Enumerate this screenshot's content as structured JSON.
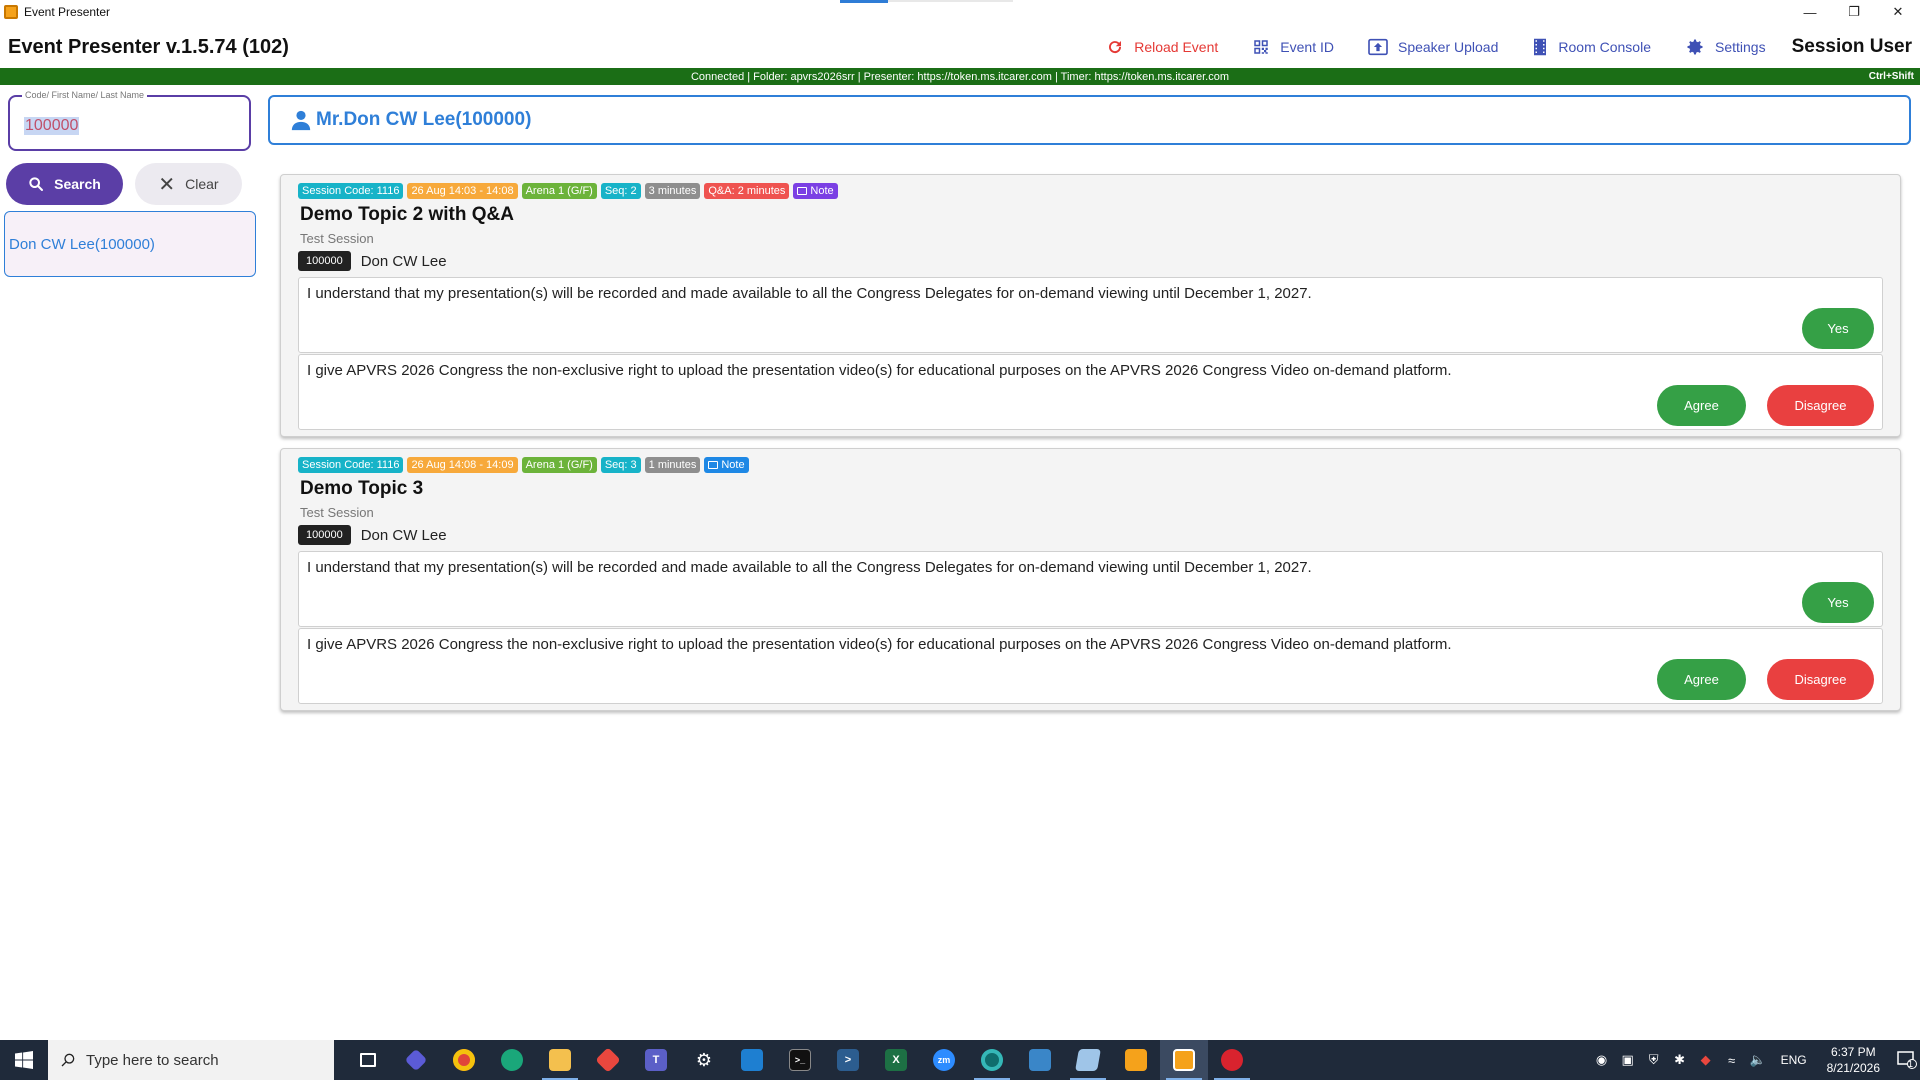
{
  "window": {
    "title": "Event Presenter"
  },
  "header": {
    "app_name": "Event Presenter v.1.5.74 (102)",
    "actions": {
      "reload": "Reload Event",
      "event_id": "Event ID",
      "speaker_upload": "Speaker Upload",
      "room_console": "Room Console",
      "settings": "Settings"
    },
    "session_user": "Session User"
  },
  "status": {
    "text": "Connected | Folder: apvrs2026srr | Presenter: https://token.ms.itcarer.com | Timer: https://token.ms.itcarer.com",
    "shortcut": "Ctrl+Shift"
  },
  "search": {
    "label": "Code/ First Name/ Last Name",
    "value": "100000",
    "search_button": "Search",
    "clear_button": "Clear",
    "results": [
      "Don CW Lee(100000)"
    ]
  },
  "presenter": {
    "name": "Mr.Don CW Lee(100000)"
  },
  "sessions": [
    {
      "badges": {
        "code": "Session Code: 1116",
        "time": "26 Aug 14:03 - 14:08",
        "room": "Arena 1 (G/F)",
        "seq": "Seq: 2",
        "duration": "3 minutes",
        "qa": "Q&A: 2 minutes",
        "note": "Note"
      },
      "title": "Demo Topic 2 with Q&A",
      "subtitle": "Test Session",
      "speaker_code": "100000",
      "speaker_name": "Don CW Lee",
      "consent1": "I understand that my presentation(s) will be recorded and made available to all the Congress Delegates for on-demand viewing until December 1, 2027.",
      "consent1_button": "Yes",
      "consent2": "I give APVRS 2026 Congress the non-exclusive right to upload the presentation video(s) for educational purposes on the APVRS 2026 Congress Video on-demand platform.",
      "agree": "Agree",
      "disagree": "Disagree"
    },
    {
      "badges": {
        "code": "Session Code: 1116",
        "time": "26 Aug 14:08 - 14:09",
        "room": "Arena 1 (G/F)",
        "seq": "Seq: 3",
        "duration": "1 minutes",
        "note": "Note"
      },
      "title": "Demo Topic 3",
      "subtitle": "Test Session",
      "speaker_code": "100000",
      "speaker_name": "Don CW Lee",
      "consent1": "I understand that my presentation(s) will be recorded and made available to all the Congress Delegates for on-demand viewing until December 1, 2027.",
      "consent1_button": "Yes",
      "consent2": "I give APVRS 2026 Congress the non-exclusive right to upload the presentation video(s) for educational purposes on the APVRS 2026 Congress Video on-demand platform.",
      "agree": "Agree",
      "disagree": "Disagree"
    }
  ],
  "taskbar": {
    "search_placeholder": "Type here to search",
    "language": "ENG",
    "time": "6:37 PM",
    "date": "8/21/2026",
    "notification_count": "1"
  },
  "colors": {
    "primary": "#5b3ea6",
    "link_blue": "#2f7fd8",
    "status_green": "#1b6e16",
    "agree_green": "#35a046",
    "disagree_red": "#e94040"
  }
}
